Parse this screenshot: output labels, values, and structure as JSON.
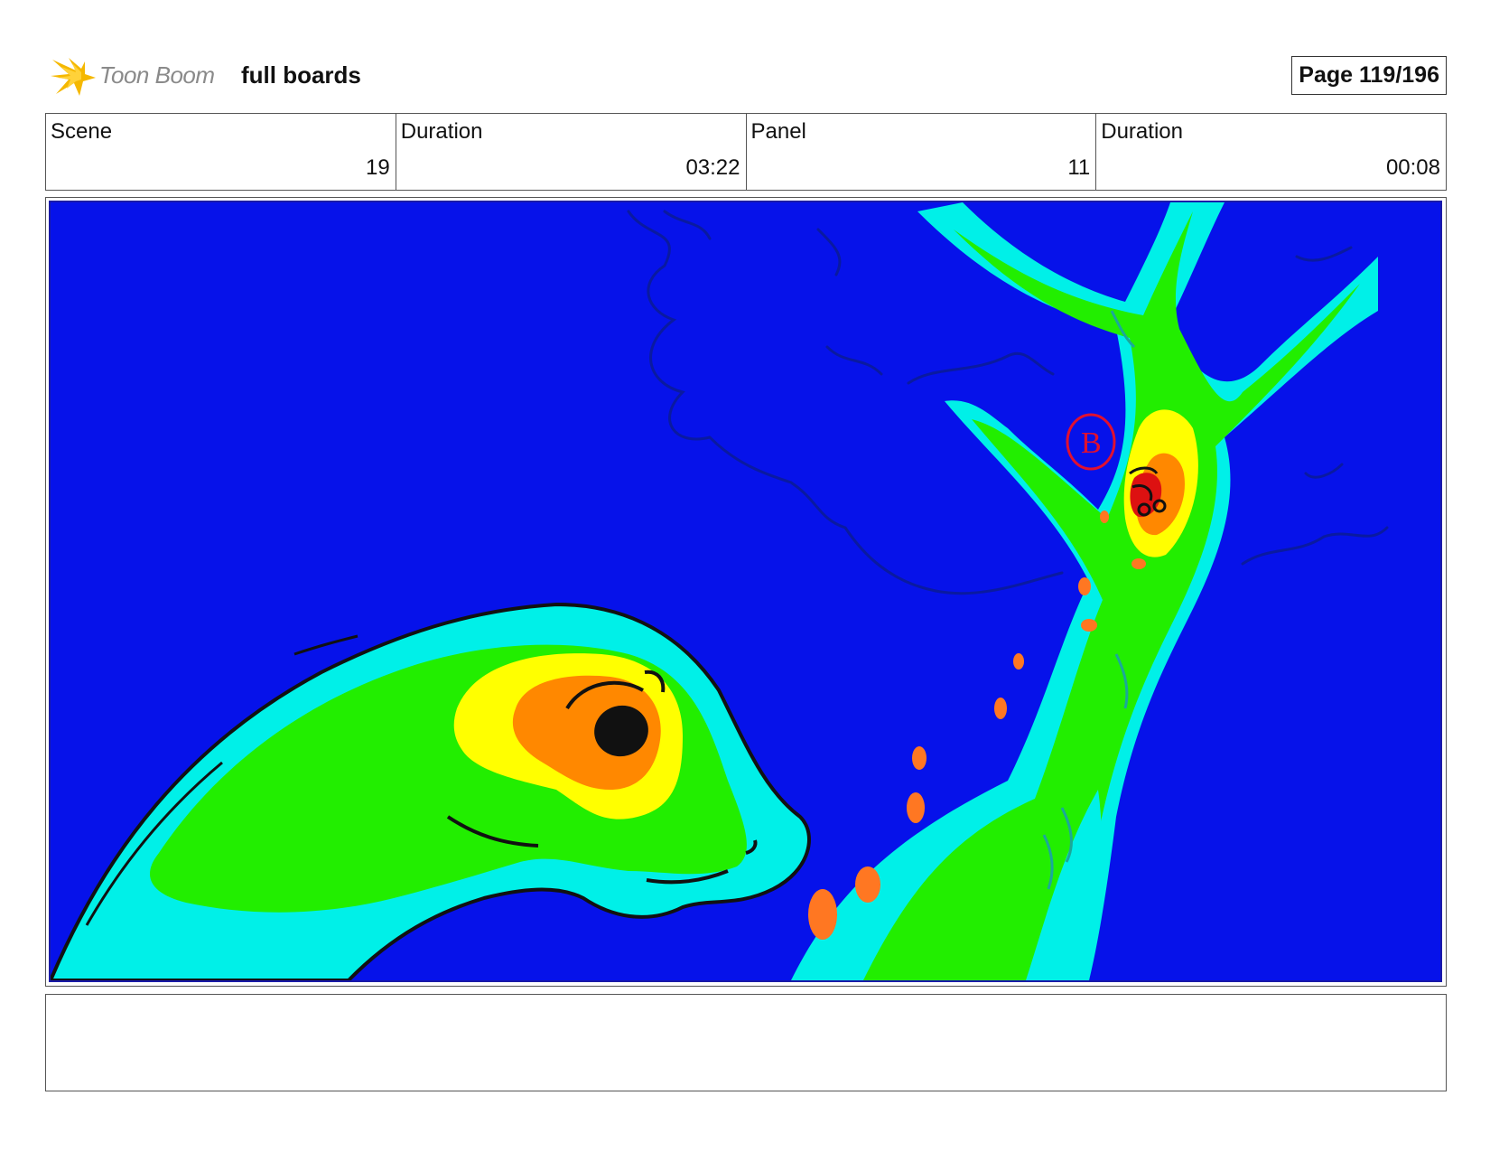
{
  "header": {
    "logo_text": "Toon Boom",
    "doc_title": "full boards",
    "page_label": "Page 119/196"
  },
  "info": {
    "scene_label": "Scene",
    "scene_value": "19",
    "scene_duration_label": "Duration",
    "scene_duration_value": "03:22",
    "panel_label": "Panel",
    "panel_value": "11",
    "panel_duration_label": "Duration",
    "panel_duration_value": "00:08"
  },
  "panel": {
    "annotation_letter": "B"
  },
  "colors": {
    "sky": "#0612ea",
    "cyan": "#00f0e8",
    "green": "#22ee00",
    "yellow": "#ffff00",
    "orange": "#ff8800",
    "red": "#dd1111"
  },
  "notes": {
    "text": ""
  }
}
